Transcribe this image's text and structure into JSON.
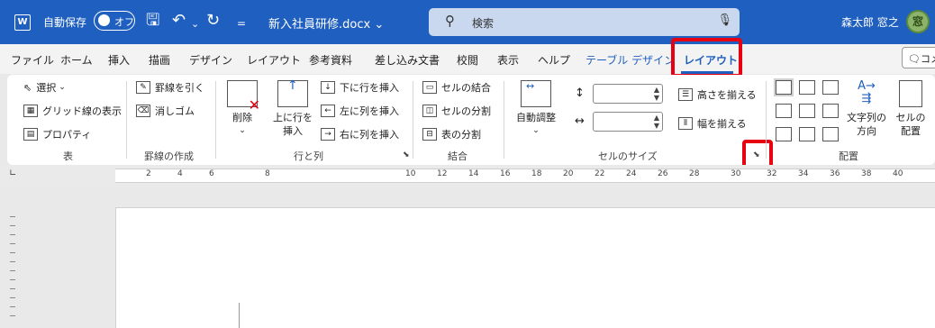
{
  "titlebar": {
    "autosave_label": "自動保存",
    "autosave_state": "オフ",
    "document_name": "新入社員研修.docx",
    "search_placeholder": "検索",
    "user_name": "森太郎 窓之",
    "avatar_text": "窓"
  },
  "menu_tabs": [
    {
      "label": "ファイル"
    },
    {
      "label": "ホーム"
    },
    {
      "label": "挿入"
    },
    {
      "label": "描画"
    },
    {
      "label": "デザイン"
    },
    {
      "label": "レイアウト"
    },
    {
      "label": "参考資料"
    },
    {
      "label": "差し込み文書"
    },
    {
      "label": "校閲"
    },
    {
      "label": "表示"
    },
    {
      "label": "ヘルプ"
    },
    {
      "label": "テーブル デザイン"
    },
    {
      "label": "レイアウト"
    }
  ],
  "comment_button": "コメ",
  "ribbon": {
    "table_group": {
      "select": "選択",
      "gridlines": "グリッド線の表示",
      "properties": "プロパティ",
      "label": "表"
    },
    "draw_group": {
      "draw_borders": "罫線を引く",
      "eraser": "消しゴム",
      "label": "罫線の作成"
    },
    "rows_cols_group": {
      "delete": "削除",
      "insert_above_1": "上に行を",
      "insert_above_2": "挿入",
      "insert_below": "下に行を挿入",
      "insert_left": "左に列を挿入",
      "insert_right": "右に列を挿入",
      "label": "行と列"
    },
    "merge_group": {
      "merge_cells": "セルの結合",
      "split_cells": "セルの分割",
      "split_table": "表の分割",
      "label": "結合"
    },
    "cell_size_group": {
      "autofit": "自動調整",
      "distribute_rows": "高さを揃える",
      "distribute_cols": "幅を揃える",
      "label": "セルのサイズ"
    },
    "alignment_group": {
      "text_direction_1": "文字列の",
      "text_direction_2": "方向",
      "cell_margins_1": "セルの",
      "cell_margins_2": "配置",
      "label": "配置"
    }
  },
  "ruler_numbers": [
    "2",
    "4",
    "6",
    "8",
    "10",
    "12",
    "14",
    "16",
    "18",
    "20",
    "22",
    "24",
    "26",
    "28",
    "30",
    "32",
    "34",
    "36",
    "38",
    "40"
  ],
  "colors": {
    "title_bar": "#1f5fc0",
    "highlight": "#e60012",
    "accent": "#1f5fc0"
  }
}
